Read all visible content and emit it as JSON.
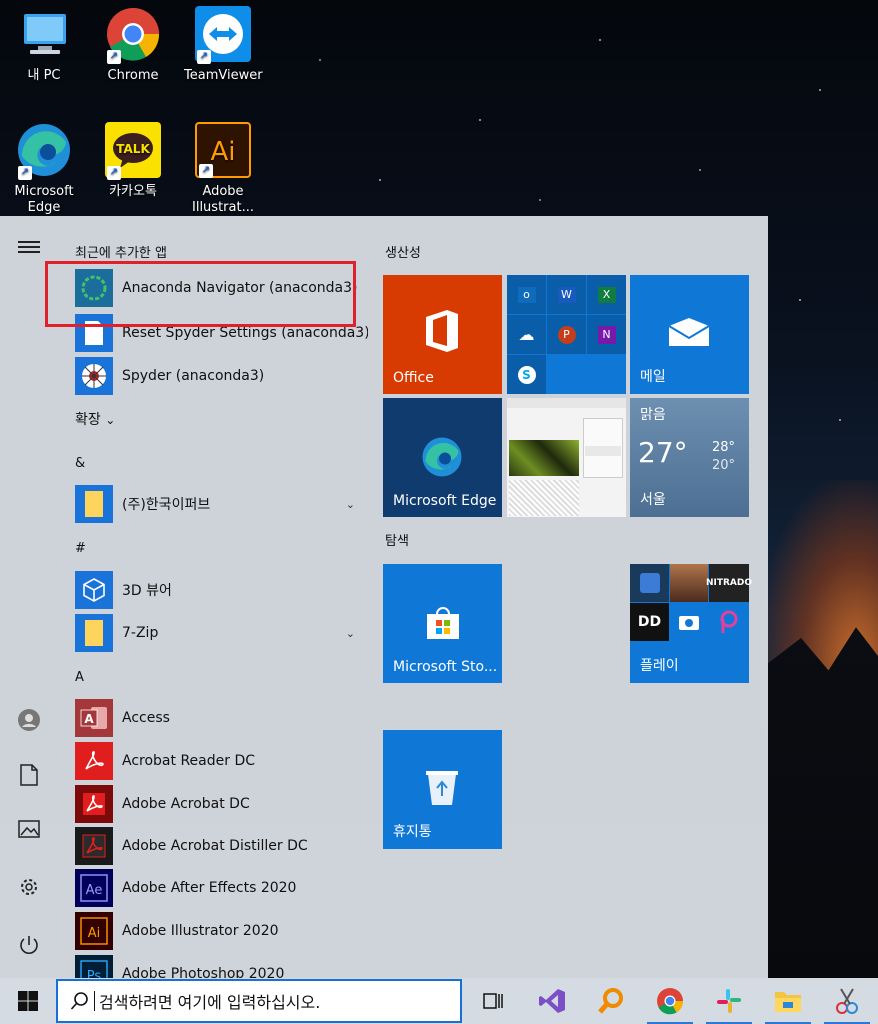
{
  "desktop": {
    "icons": [
      {
        "label": "내 PC",
        "icon": "monitor-icon"
      },
      {
        "label": "Chrome",
        "icon": "chrome-icon"
      },
      {
        "label": "TeamViewer",
        "icon": "teamviewer-icon"
      },
      {
        "label": "Microsoft Edge",
        "icon": "edge-icon"
      },
      {
        "label": "카카오톡",
        "icon": "kakaotalk-icon"
      },
      {
        "label": "Adobe Illustrat...",
        "icon": "illustrator-icon"
      }
    ]
  },
  "start_menu": {
    "recent_header": "최근에 추가한 앱",
    "recent": [
      {
        "label": "Anaconda Navigator (anaconda3)",
        "icon": "anaconda-icon"
      },
      {
        "label": "Reset Spyder Settings (anaconda3)",
        "icon": "document-icon"
      },
      {
        "label": "Spyder (anaconda3)",
        "icon": "spyder-icon"
      }
    ],
    "expand_label": "확장",
    "expand_chevron": "⌄",
    "groups": [
      {
        "letter": "&",
        "items": [
          {
            "label": "(주)한국이퍼브",
            "icon": "folder-icon",
            "has_chevron": true
          }
        ]
      },
      {
        "letter": "#",
        "items": [
          {
            "label": "3D 뷰어",
            "icon": "cube-icon",
            "has_chevron": false
          },
          {
            "label": "7-Zip",
            "icon": "folder-icon",
            "has_chevron": true
          }
        ]
      },
      {
        "letter": "A",
        "items": [
          {
            "label": "Access",
            "icon": "access-icon"
          },
          {
            "label": "Acrobat Reader DC",
            "icon": "acrobat-reader-icon"
          },
          {
            "label": "Adobe Acrobat DC",
            "icon": "acrobat-icon"
          },
          {
            "label": "Adobe Acrobat Distiller DC",
            "icon": "distiller-icon"
          },
          {
            "label": "Adobe After Effects 2020",
            "icon": "after-effects-icon"
          },
          {
            "label": "Adobe Illustrator 2020",
            "icon": "illustrator-icon"
          },
          {
            "label": "Adobe Photoshop 2020",
            "icon": "photoshop-icon"
          }
        ]
      }
    ],
    "rail": [
      "hamburger-icon",
      "user-icon",
      "document-icon",
      "pictures-icon",
      "settings-icon",
      "power-icon"
    ],
    "tiles": {
      "group1_title": "생산성",
      "group2_title": "탐색",
      "office": "Office",
      "mail": "메일",
      "edge": "Microsoft Edge",
      "weather": {
        "condition": "맑음",
        "temp": "27°",
        "high": "28°",
        "low": "20°",
        "city": "서울"
      },
      "store": "Microsoft Sto...",
      "play": "플레이",
      "play_thumb_text": "NITRADO",
      "recycle": "휴지통",
      "office_apps": [
        {
          "letter": "o",
          "color": "#0f6cbd",
          "icon": "outlook-icon"
        },
        {
          "letter": "W",
          "color": "#185abd",
          "icon": "word-icon"
        },
        {
          "letter": "X",
          "color": "#107c41",
          "icon": "excel-icon"
        },
        {
          "letter": "☁",
          "color": "#0a64c8",
          "icon": "onedrive-icon"
        },
        {
          "letter": "P",
          "color": "#c43e1c",
          "icon": "powerpoint-icon"
        },
        {
          "letter": "N",
          "color": "#7719aa",
          "icon": "onenote-icon"
        },
        {
          "letter": "S",
          "color": "#00a9f0",
          "icon": "skype-icon"
        }
      ]
    }
  },
  "taskbar": {
    "search_placeholder": "검색하려면 여기에 입력하십시오.",
    "apps": [
      "task-view-icon",
      "visual-studio-icon",
      "search-app-icon",
      "chrome-icon",
      "slack-icon",
      "file-explorer-icon",
      "snipping-icon"
    ]
  },
  "colors": {
    "accent": "#0f78d7",
    "office": "#d83b01",
    "highlight": "#e0202a"
  }
}
